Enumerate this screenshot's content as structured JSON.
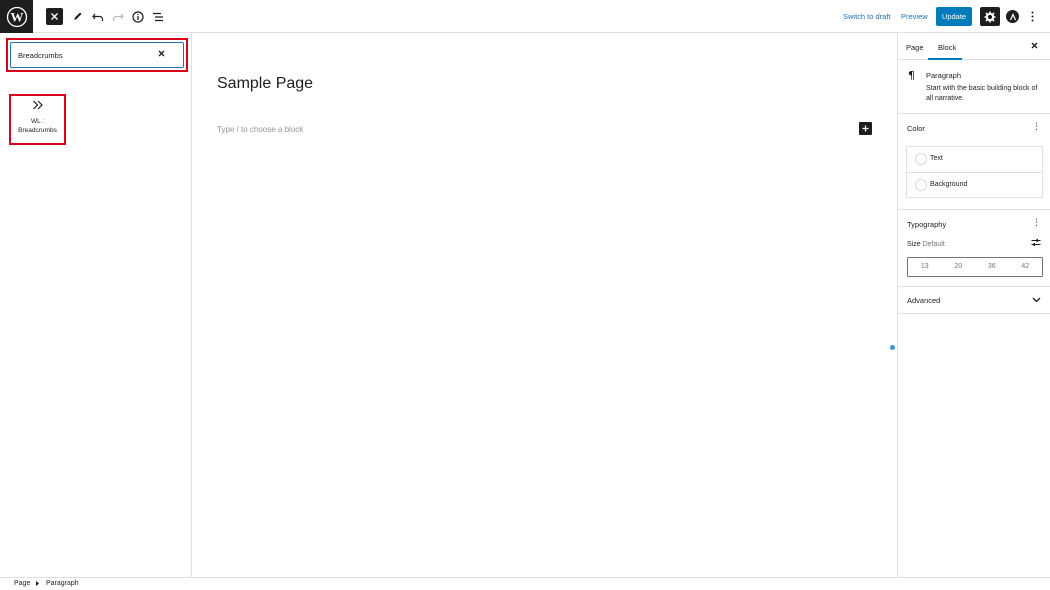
{
  "header": {
    "switch_to_draft": "Switch to draft",
    "preview": "Preview",
    "update": "Update"
  },
  "inserter": {
    "search_value": "Breadcrumbs",
    "results": [
      {
        "label_line1": "WL :",
        "label_line2": "Breadcrumbs",
        "icon": "double-chevron-right-icon"
      }
    ]
  },
  "editor": {
    "title": "Sample Page",
    "placeholder": "Type / to choose a block"
  },
  "sidebar": {
    "tabs": [
      "Page",
      "Block"
    ],
    "active_tab": "Block",
    "block": {
      "name": "Paragraph",
      "description": "Start with the basic building block of all narrative."
    },
    "color": {
      "title": "Color",
      "items": [
        "Text",
        "Background"
      ]
    },
    "typography": {
      "title": "Typography",
      "size_label": "Size",
      "size_value": "Default",
      "sizes": [
        "13",
        "20",
        "36",
        "42"
      ]
    },
    "advanced": {
      "title": "Advanced"
    }
  },
  "breadcrumb": [
    "Page",
    "Paragraph"
  ],
  "colors": {
    "accent": "#007cba",
    "highlight": "#d9001b",
    "dark": "#1e1e1e"
  }
}
